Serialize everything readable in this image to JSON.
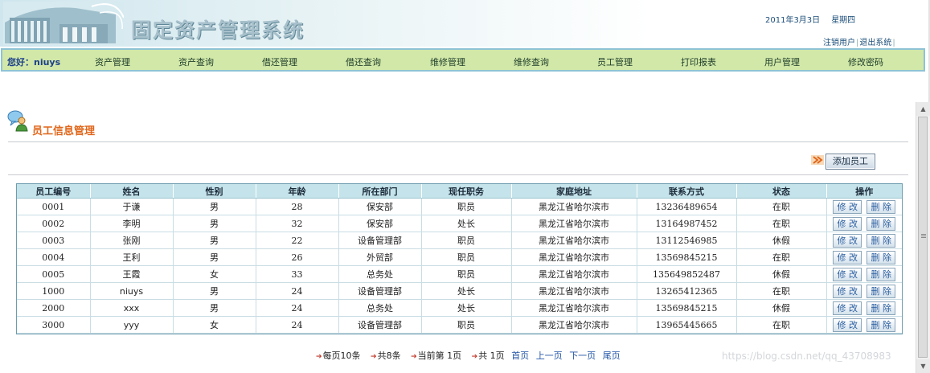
{
  "header": {
    "title": "固定资产管理系统",
    "date": "2011年3月3日",
    "weekday": "星期四",
    "links": {
      "logout_user": "注销用户",
      "exit_system": "退出系统"
    }
  },
  "nav": {
    "greeting": "您好：",
    "username": "niuys",
    "items": [
      "资产管理",
      "资产查询",
      "借还管理",
      "借还查询",
      "维修管理",
      "维修查询",
      "员工管理",
      "打印报表",
      "用户管理",
      "修改密码"
    ]
  },
  "section": {
    "title": "员工信息管理",
    "add_button": "添加员工"
  },
  "table": {
    "headers": [
      "员工编号",
      "姓名",
      "性别",
      "年龄",
      "所在部门",
      "现任职务",
      "家庭地址",
      "联系方式",
      "状态",
      "操作"
    ],
    "rows": [
      [
        "0001",
        "于谦",
        "男",
        "28",
        "保安部",
        "职员",
        "黑龙江省哈尔滨市",
        "13236489654",
        "在职"
      ],
      [
        "0002",
        "李明",
        "男",
        "32",
        "保安部",
        "处长",
        "黑龙江省哈尔滨市",
        "13164987452",
        "在职"
      ],
      [
        "0003",
        "张刚",
        "男",
        "22",
        "设备管理部",
        "职员",
        "黑龙江省哈尔滨市",
        "13112546985",
        "休假"
      ],
      [
        "0004",
        "王利",
        "男",
        "26",
        "外贸部",
        "职员",
        "黑龙江省哈尔滨市",
        "13569845215",
        "在职"
      ],
      [
        "0005",
        "王霞",
        "女",
        "33",
        "总务处",
        "职员",
        "黑龙江省哈尔滨市",
        "135649852487",
        "休假"
      ],
      [
        "1000",
        "niuys",
        "男",
        "24",
        "设备管理部",
        "处长",
        "黑龙江省哈尔滨市",
        "13265412365",
        "在职"
      ],
      [
        "2000",
        "xxx",
        "男",
        "24",
        "总务处",
        "处长",
        "黑龙江省哈尔滨市",
        "13569845215",
        "休假"
      ],
      [
        "3000",
        "yyy",
        "女",
        "24",
        "设备管理部",
        "职员",
        "黑龙江省哈尔滨市",
        "13965445665",
        "在职"
      ]
    ],
    "edit_label": "修 改",
    "delete_label": "删 除"
  },
  "pagination": {
    "per_page": "每页10条",
    "total": "共8条",
    "current": "当前第 1页",
    "pages": "共 1页",
    "first": "首页",
    "prev": "上一页",
    "next": "下一页",
    "last": "尾页"
  },
  "watermark": "https://blog.csdn.net/qq_43708983"
}
